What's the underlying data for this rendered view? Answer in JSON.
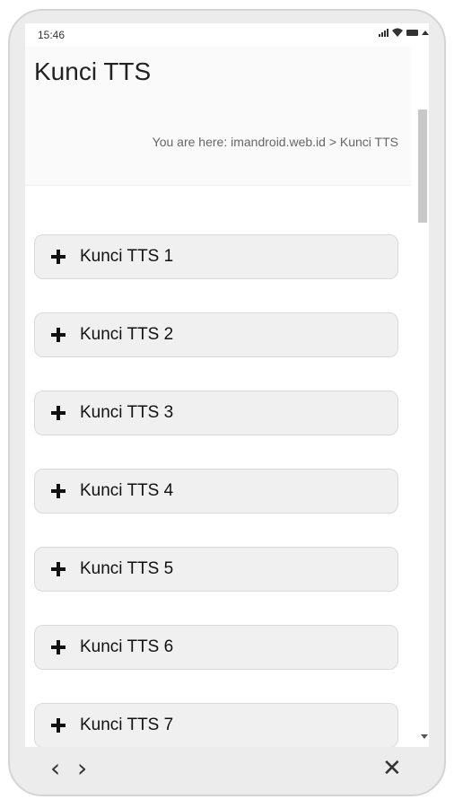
{
  "status_bar": {
    "time": "15:46",
    "icons": [
      "signal-icon",
      "wifi-icon",
      "battery-icon",
      "caret-up-icon"
    ]
  },
  "header": {
    "title": "Kunci TTS",
    "breadcrumb": "You are here: imandroid.web.id > Kunci TTS"
  },
  "accordion": {
    "items": [
      {
        "label": "Kunci TTS 1"
      },
      {
        "label": "Kunci TTS 2"
      },
      {
        "label": "Kunci TTS 3"
      },
      {
        "label": "Kunci TTS 4"
      },
      {
        "label": "Kunci TTS 5"
      },
      {
        "label": "Kunci TTS 6"
      },
      {
        "label": "Kunci TTS 7"
      }
    ]
  },
  "bottom_nav": {
    "back_glyph": "‹",
    "forward_glyph": "›",
    "close_glyph": "✕"
  },
  "colors": {
    "accordion_bg": "#f0f0f0",
    "accordion_border": "#dadada",
    "frame_bg": "#ececec"
  }
}
